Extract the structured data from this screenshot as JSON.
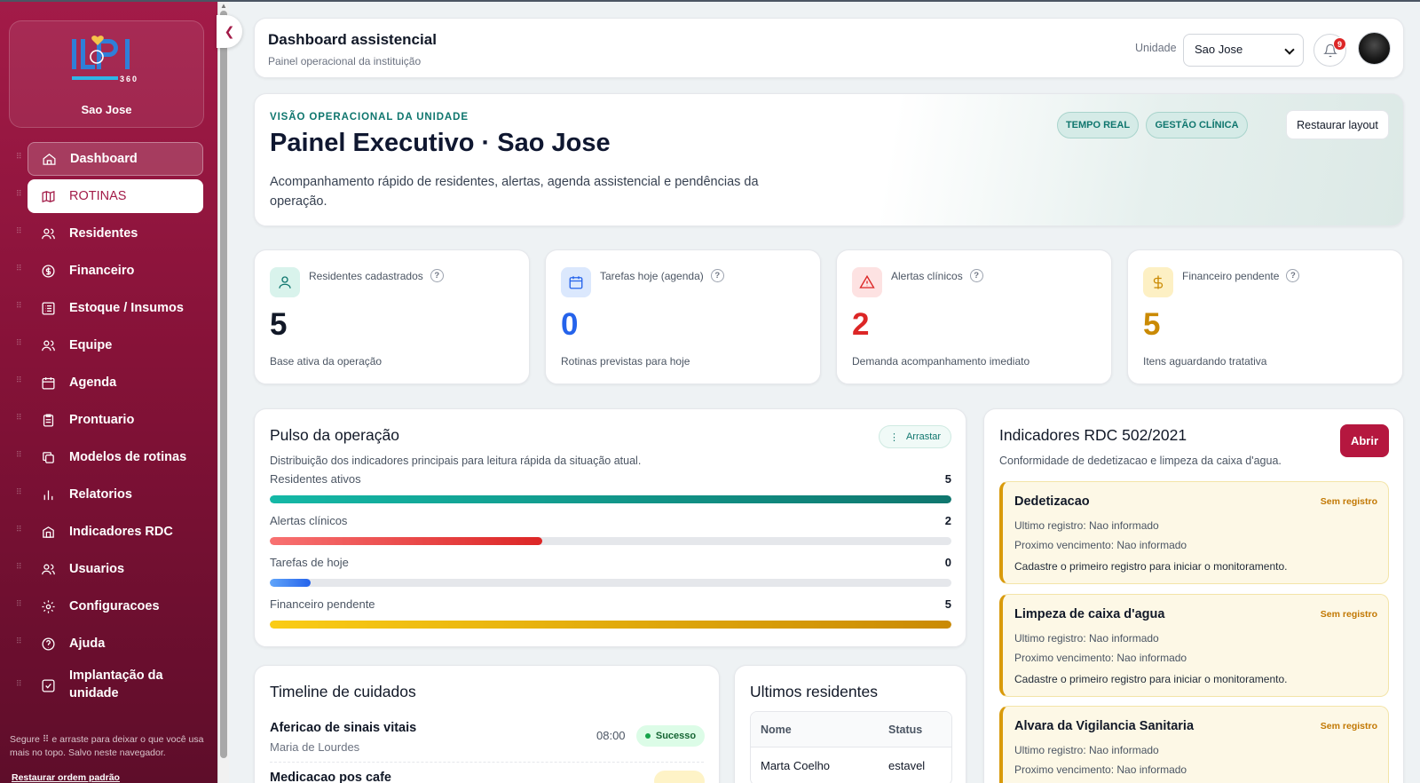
{
  "sidebar": {
    "unit_name": "Sao Jose",
    "logo_text": "360",
    "items": [
      {
        "label": "Dashboard",
        "icon": "home-icon"
      },
      {
        "label": "ROTINAS",
        "icon": "map-icon"
      },
      {
        "label": "Residentes",
        "icon": "users-icon"
      },
      {
        "label": "Financeiro",
        "icon": "dollar-icon"
      },
      {
        "label": "Estoque / Insumos",
        "icon": "list-icon"
      },
      {
        "label": "Equipe",
        "icon": "users-icon"
      },
      {
        "label": "Agenda",
        "icon": "calendar-icon"
      },
      {
        "label": "Prontuario",
        "icon": "clipboard-icon"
      },
      {
        "label": "Modelos de rotinas",
        "icon": "copy-icon"
      },
      {
        "label": "Relatorios",
        "icon": "bar-chart-icon"
      },
      {
        "label": "Indicadores RDC",
        "icon": "building-icon"
      },
      {
        "label": "Usuarios",
        "icon": "users-icon"
      },
      {
        "label": "Configuracoes",
        "icon": "gear-icon"
      },
      {
        "label": "Ajuda",
        "icon": "help-icon"
      },
      {
        "label": "Implantação da unidade",
        "icon": "check-square-icon"
      }
    ],
    "help_text": "Segure ⠿ e arraste para deixar o que você usa mais no topo. Salvo neste navegador.",
    "reset_link": "Restaurar ordem padrão"
  },
  "header": {
    "title": "Dashboard assistencial",
    "subtitle": "Painel operacional da instituição",
    "unit_label": "Unidade",
    "unit_value": "Sao Jose",
    "notifications": "9"
  },
  "hero": {
    "eyebrow": "VISÃO OPERACIONAL DA UNIDADE",
    "title": "Painel Executivo · Sao Jose",
    "description": "Acompanhamento rápido de residentes, alertas, agenda assistencial e pendências da operação.",
    "pill_realtime": "TEMPO REAL",
    "pill_clinical": "GESTÃO CLÍNICA",
    "restore_button": "Restaurar layout"
  },
  "kpis": [
    {
      "label": "Residentes cadastrados",
      "value": "5",
      "sub": "Base ativa da operação",
      "color": "#111827"
    },
    {
      "label": "Tarefas hoje (agenda)",
      "value": "0",
      "sub": "Rotinas previstas para hoje",
      "color": "#2563eb"
    },
    {
      "label": "Alertas clínicos",
      "value": "2",
      "sub": "Demanda acompanhamento imediato",
      "color": "#dc2626"
    },
    {
      "label": "Financeiro pendente",
      "value": "5",
      "sub": "Itens aguardando tratativa",
      "color": "#ca8a04"
    }
  ],
  "pulse": {
    "title": "Pulso da operação",
    "subtitle": "Distribuição dos indicadores principais para leitura rápida da situação atual.",
    "drag_label": "Arrastar",
    "rows": [
      {
        "label": "Residentes ativos",
        "value": "5",
        "fill_percent": 100
      },
      {
        "label": "Alertas clínicos",
        "value": "2",
        "fill_percent": 40
      },
      {
        "label": "Tarefas de hoje",
        "value": "0",
        "fill_percent": 6
      },
      {
        "label": "Financeiro pendente",
        "value": "5",
        "fill_percent": 100
      }
    ]
  },
  "rdc": {
    "title": "Indicadores RDC 502/2021",
    "subtitle": "Conformidade de dedetizacao e limpeza da caixa d'agua.",
    "open_button": "Abrir",
    "items": [
      {
        "name": "Dedetizacao",
        "status": "Sem registro",
        "last": "Ultimo registro: Nao informado",
        "next": "Proximo vencimento: Nao informado",
        "hint": "Cadastre o primeiro registro para iniciar o monitoramento."
      },
      {
        "name": "Limpeza de caixa d'agua",
        "status": "Sem registro",
        "last": "Ultimo registro: Nao informado",
        "next": "Proximo vencimento: Nao informado",
        "hint": "Cadastre o primeiro registro para iniciar o monitoramento."
      },
      {
        "name": "Alvara da Vigilancia Sanitaria",
        "status": "Sem registro",
        "last": "Ultimo registro: Nao informado",
        "next": "Proximo vencimento: Nao informado",
        "hint": ""
      }
    ]
  },
  "timeline": {
    "title": "Timeline de cuidados",
    "items": [
      {
        "title": "Afericao de sinais vitais",
        "person": "Maria de Lourdes",
        "time": "08:00",
        "status": "Sucesso"
      },
      {
        "title": "Medicacao pos cafe"
      }
    ]
  },
  "residents": {
    "title": "Ultimos residentes",
    "col_name": "Nome",
    "col_status": "Status",
    "rows": [
      {
        "name": "Marta Coelho",
        "status": "estavel"
      }
    ]
  }
}
